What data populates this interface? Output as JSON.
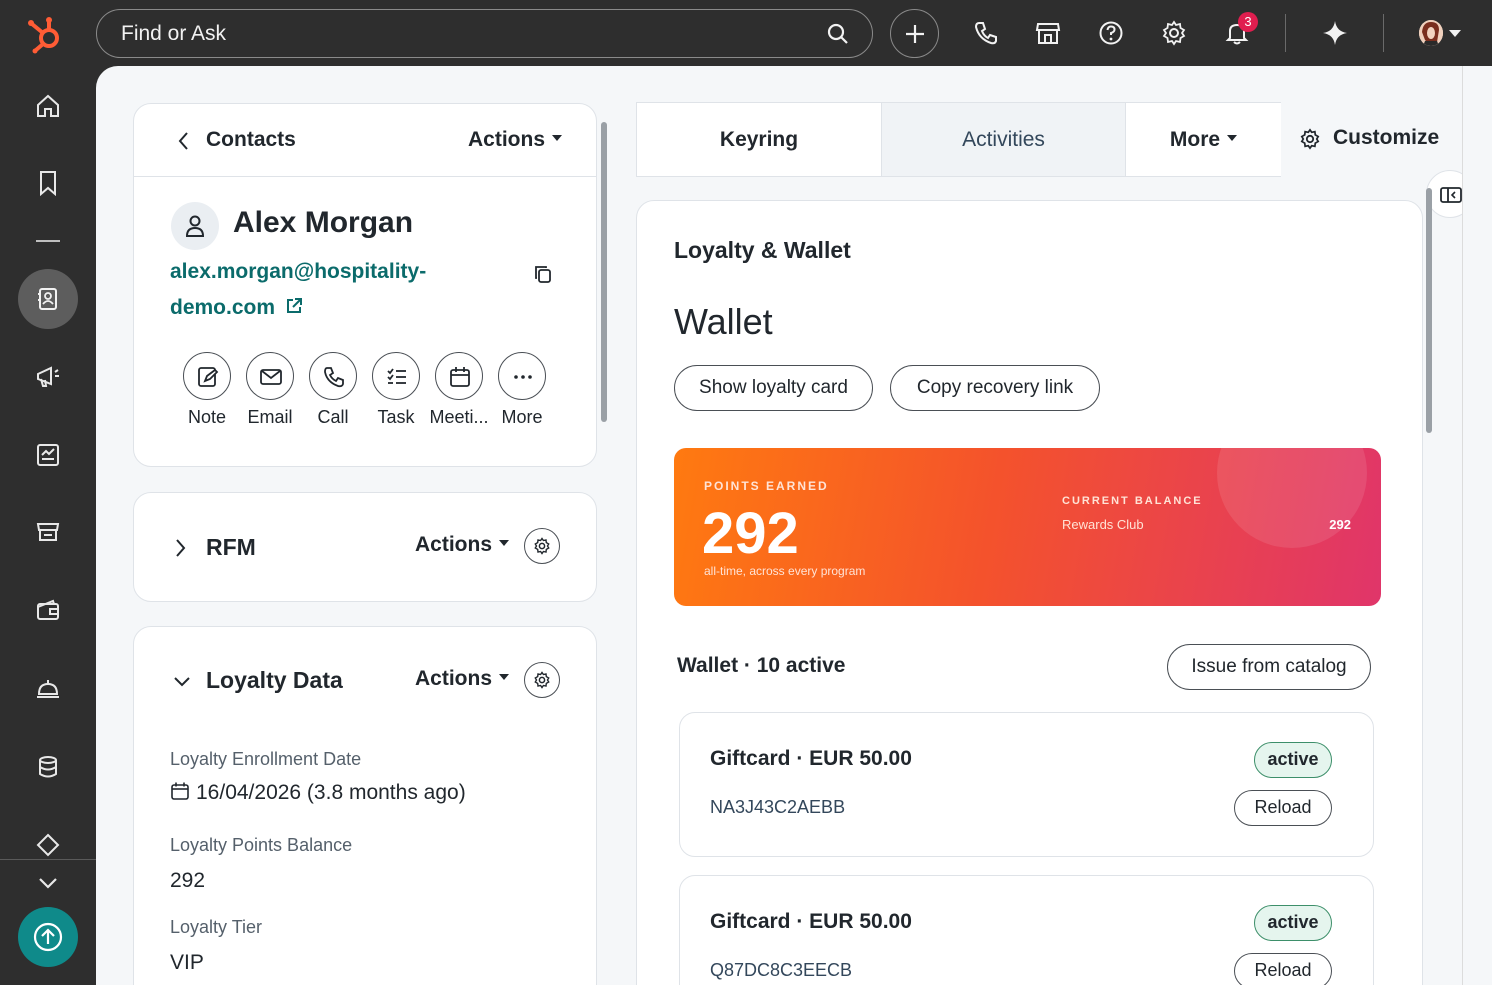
{
  "topbar": {
    "search_placeholder": "Find or Ask",
    "notification_count": "3",
    "icons": [
      "search-icon",
      "add-icon",
      "phone-icon",
      "marketplace-icon",
      "help-icon",
      "settings-icon",
      "bell-icon",
      "ai-sparkle-icon",
      "avatar"
    ]
  },
  "leftnav": {
    "items": [
      "home-icon",
      "bookmark-icon",
      "contacts-icon",
      "marketing-icon",
      "content-icon",
      "commerce-icon",
      "wallet-icon",
      "service-icon",
      "data-icon",
      "automation-icon",
      "expand-icon"
    ],
    "active": "contacts-icon"
  },
  "contact": {
    "back_label": "Contacts",
    "actions_label": "Actions",
    "name": "Alex Morgan",
    "email_line1": "alex.morgan@hospitality-",
    "email_line2": "demo.com",
    "quick_actions": [
      "Note",
      "Email",
      "Call",
      "Task",
      "Meeti...",
      "More"
    ]
  },
  "rfm": {
    "title": "RFM",
    "actions_label": "Actions"
  },
  "loyalty_data": {
    "title": "Loyalty Data",
    "actions_label": "Actions",
    "props": [
      {
        "label": "Loyalty Enrollment Date",
        "value": "16/04/2026 (3.8 months ago)"
      },
      {
        "label": "Loyalty Points Balance",
        "value": "292"
      },
      {
        "label": "Loyalty Tier",
        "value": "VIP"
      }
    ]
  },
  "tabs": [
    "Keyring",
    "Activities",
    "More"
  ],
  "customize_label": "Customize",
  "panel": {
    "title": "Loyalty & Wallet",
    "heading": "Wallet",
    "show_card_label": "Show loyalty card",
    "copy_link_label": "Copy recovery link",
    "promo": {
      "points_label": "POINTS EARNED",
      "points_value": "292",
      "points_sub": "all-time, across every program",
      "balance_label": "CURRENT BALANCE",
      "program": "Rewards Club",
      "balance_value": "292"
    },
    "wallet_count": "Wallet · 10 active",
    "issue_label": "Issue from catalog",
    "giftcards": [
      {
        "title": "Giftcard · EUR 50.00",
        "code": "NA3J43C2AEBB",
        "status": "active",
        "action": "Reload"
      },
      {
        "title": "Giftcard · EUR 50.00",
        "code": "Q87DC8C3EECB",
        "status": "active",
        "action": "Reload"
      }
    ]
  },
  "colors": {
    "accent_teal": "#0b6b6b",
    "promo_start": "#ff7a10",
    "promo_end": "#e0356a",
    "badge_red": "#e01e4f"
  }
}
